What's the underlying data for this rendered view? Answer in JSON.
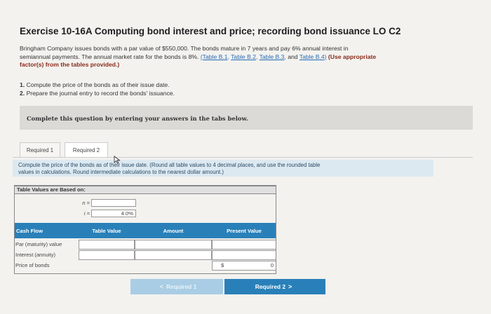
{
  "exercise": {
    "title": "Exercise 10-16A Computing bond interest and price; recording bond issuance LO C2",
    "problem_text_1": "Bringham Company issues bonds with a par value of $550,000. The bonds mature in 7 years and pay 6% annual interest in",
    "problem_text_2": "semiannual payments. The annual market rate for the bonds is 8%.",
    "links": [
      "(Table B.1,",
      "Table B.2,",
      "Table B.3,",
      "and",
      "Table B.4)"
    ],
    "use_note": "(Use appropriate",
    "use_note_2": "factor(s) from the tables provided.)",
    "task_1_num": "1.",
    "task_1": "Compute the price of the bonds as of their issue date.",
    "task_2_num": "2.",
    "task_2": "Prepare the journal entry to record the bonds' issuance."
  },
  "instructions": "Complete this question by entering your answers in the tabs below.",
  "tabs": [
    {
      "label": "Required 1"
    },
    {
      "label": "Required 2"
    }
  ],
  "requirement_note_1": "Compute the price of the bonds as of their issue date. (Round all table values to 4 decimal places, and use the rounded table",
  "requirement_note_2": "values in calculations. Round intermediate calculations to the nearest dollar amount.)",
  "table": {
    "header": "Table Values are Based on:",
    "n_label": "n =",
    "n_value": "",
    "i_label": "i =",
    "i_value": "4.0%",
    "columns": [
      "Cash Flow",
      "Table Value",
      "Amount",
      "Present Value"
    ],
    "rows": [
      {
        "name": "Par (maturity) value",
        "table_value": "",
        "amount": "",
        "present_value": ""
      },
      {
        "name": "Interest (annuity)",
        "table_value": "",
        "amount": "",
        "present_value": ""
      },
      {
        "name": "Price of bonds",
        "table_value": "",
        "amount": "",
        "currency": "$",
        "present_value": "0"
      }
    ]
  },
  "nav": {
    "prev_label": "Required 1",
    "next_label": "Required 2",
    "prev_chevron": "<",
    "next_chevron": ">"
  },
  "colors": {
    "accent": "#2980b9",
    "accent_disabled": "#a9cde4",
    "note_bg": "#dde9f1"
  }
}
